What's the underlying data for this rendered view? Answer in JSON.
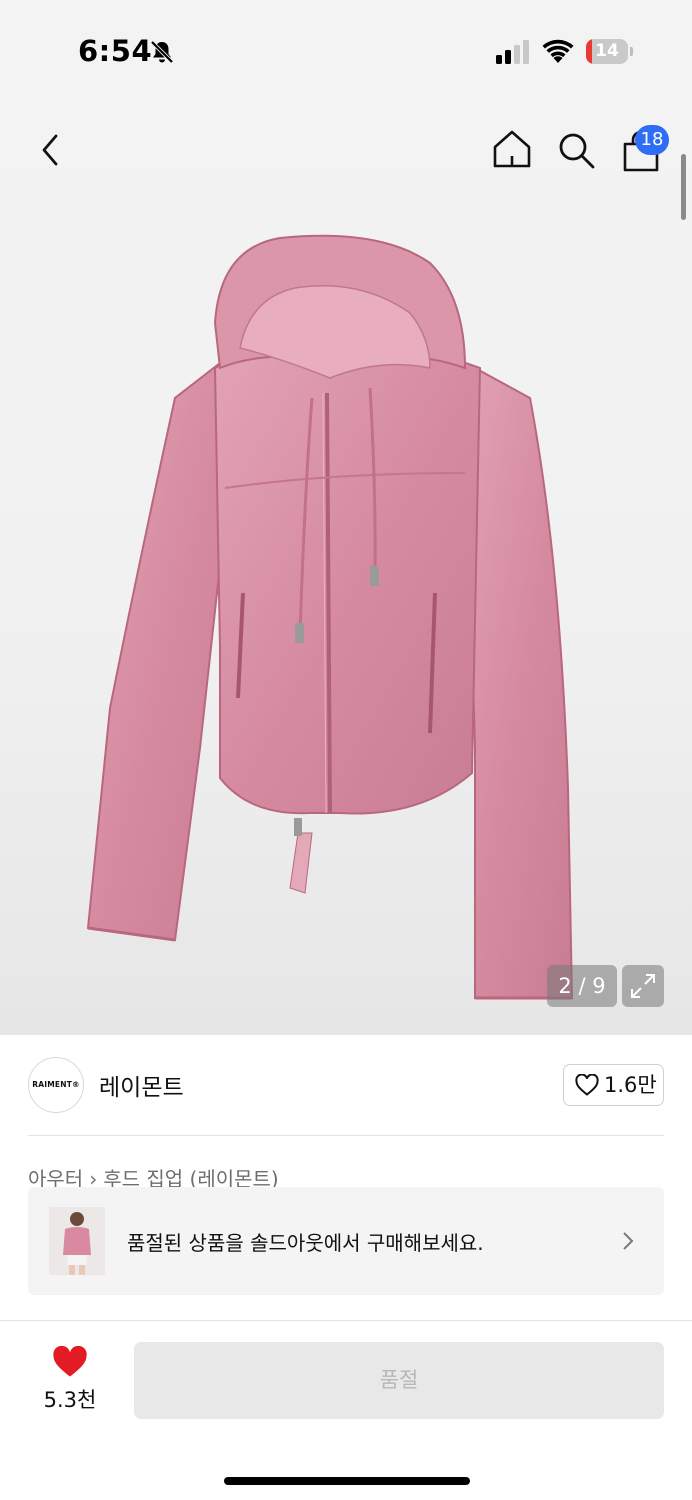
{
  "status_bar": {
    "time": "6:54",
    "battery": "14",
    "battery_level": 0.14
  },
  "header": {
    "cart_count": "18"
  },
  "gallery": {
    "counter": "2 / 9"
  },
  "brand": {
    "logo_text": "RAIMENT®",
    "name": "레이몬트",
    "like_count": "1.6만"
  },
  "breadcrumb": {
    "category": "아우터",
    "subcategory": "후드 집업 (레이몬트)"
  },
  "soldout_banner": {
    "text": "품절된 상품을 솔드아웃에서 구매해보세요."
  },
  "bottom_bar": {
    "wish_count": "5.3천",
    "button_label": "품절"
  },
  "colors": {
    "accent": "#2f6df6",
    "heart": "#e31b23",
    "product": "#d98aa0"
  }
}
